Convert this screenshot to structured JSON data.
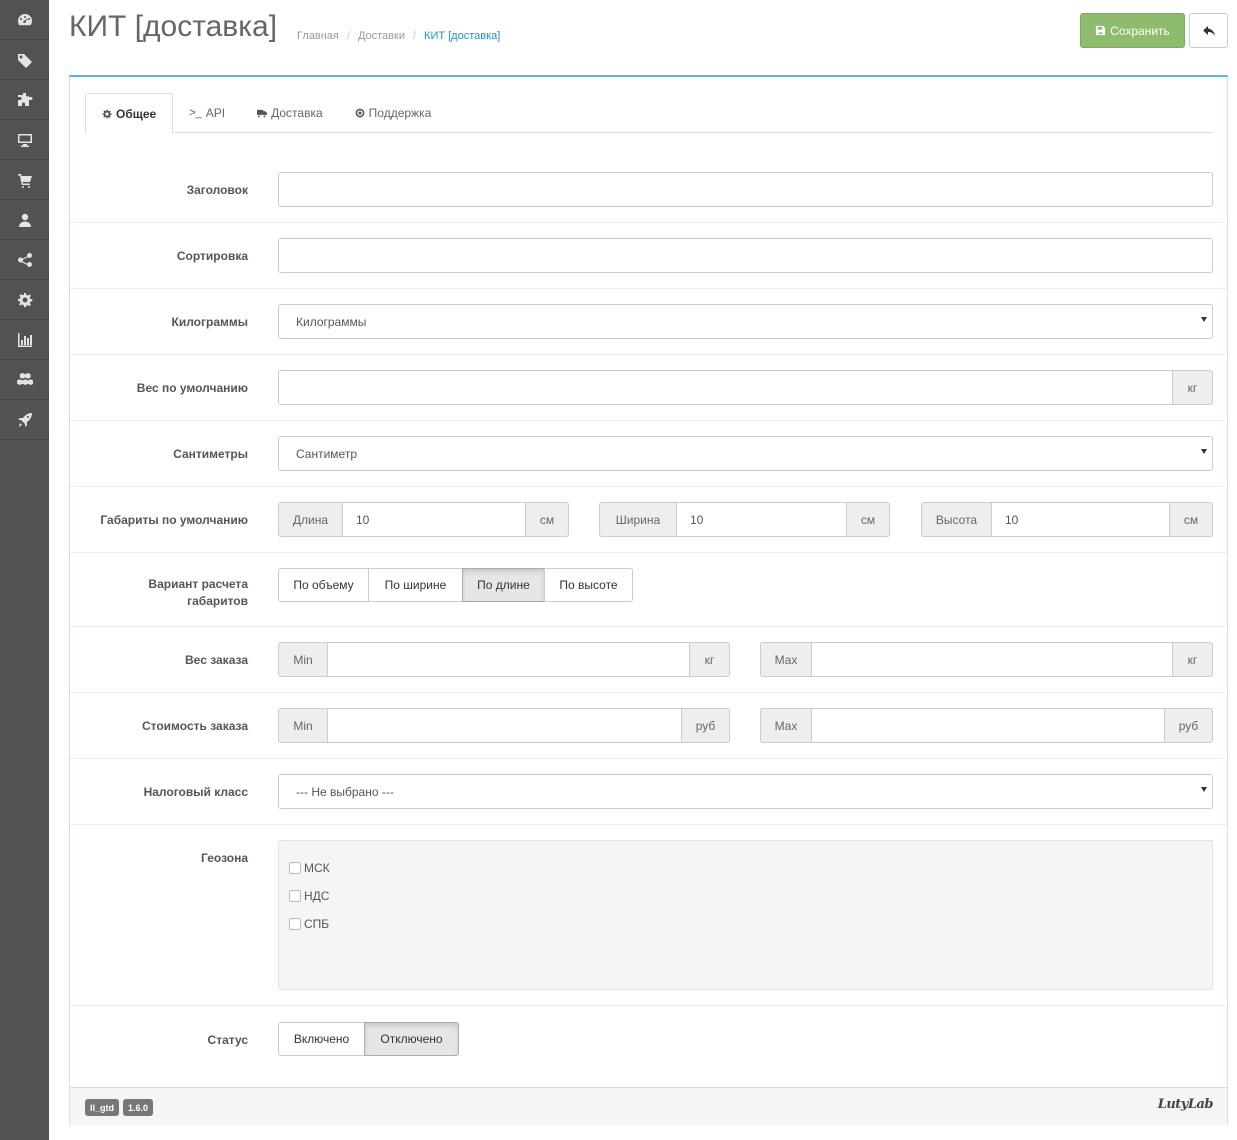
{
  "sidebar": {
    "icons": [
      "dashboard-icon",
      "tags-icon",
      "puzzle-icon",
      "desktop-icon",
      "cart-icon",
      "user-icon",
      "share-icon",
      "gear-icon",
      "chart-icon",
      "cubes-icon",
      "rocket-icon"
    ]
  },
  "header": {
    "title": "КИТ [доставка]",
    "breadcrumbs": [
      "Главная",
      "Доставки",
      "КИТ [доставка]"
    ],
    "save_label": "Сохранить"
  },
  "tabs": [
    {
      "label": "Общее",
      "icon": "gear-icon"
    },
    {
      "label": "API",
      "icon": "terminal-icon"
    },
    {
      "label": "Доставка",
      "icon": "truck-icon"
    },
    {
      "label": "Поддержка",
      "icon": "life-ring-icon"
    }
  ],
  "form": {
    "title_label": "Заголовок",
    "title_value": "",
    "sort_label": "Сортировка",
    "sort_value": "",
    "kg_label": "Килограммы",
    "kg_value": "Килограммы",
    "weight_label": "Вес по умолчанию",
    "weight_value": "",
    "weight_unit": "кг",
    "cm_label": "Сантиметры",
    "cm_value": "Сантиметр",
    "dims_label": "Габариты по умолчанию",
    "dims": [
      {
        "label": "Длина",
        "value": "10",
        "unit": "см"
      },
      {
        "label": "Ширина",
        "value": "10",
        "unit": "см"
      },
      {
        "label": "Высота",
        "value": "10",
        "unit": "см"
      }
    ],
    "calc_label_line1": "Вариант расчета",
    "calc_label_line2": "габаритов",
    "calc_options": [
      "По объему",
      "По ширине",
      "По длине",
      "По высоте"
    ],
    "calc_selected": "По длине",
    "order_weight_label": "Вес заказа",
    "order_weight": {
      "min_label": "Min",
      "min_value": "",
      "min_unit": "кг",
      "max_label": "Max",
      "max_value": "",
      "max_unit": "кг"
    },
    "order_cost_label": "Стоимость заказа",
    "order_cost": {
      "min_label": "Min",
      "min_value": "",
      "min_unit": "руб",
      "max_label": "Max",
      "max_value": "",
      "max_unit": "руб"
    },
    "tax_label": "Налоговый класс",
    "tax_value": "--- Не выбрано ---",
    "geo_label": "Геозона",
    "geo_zones": [
      {
        "label": "МСК",
        "checked": false
      },
      {
        "label": "НДС",
        "checked": false
      },
      {
        "label": "СПБ",
        "checked": false
      }
    ],
    "status_label": "Статус",
    "status_options": [
      "Включено",
      "Отключено"
    ],
    "status_selected": "Отключено"
  },
  "footer": {
    "badge1": "ll_gtd",
    "badge2": "1.6.0",
    "logo": "LutyLab"
  }
}
